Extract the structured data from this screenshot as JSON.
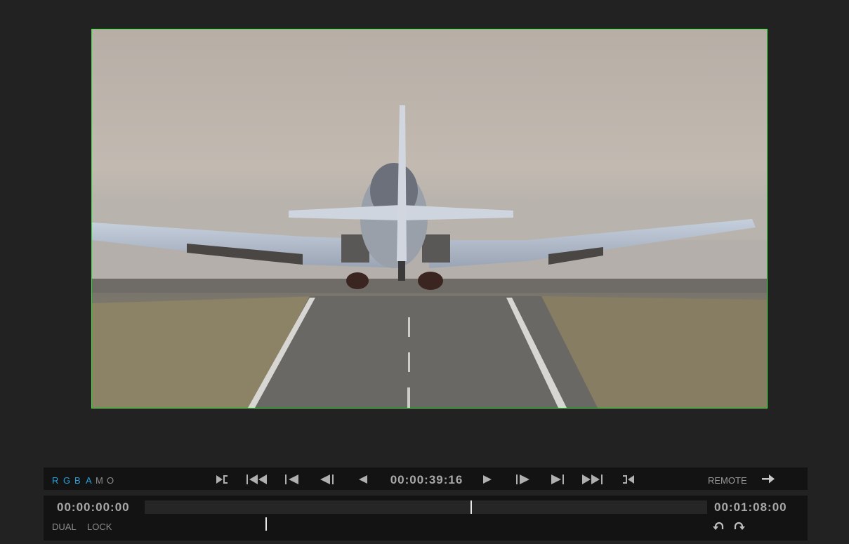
{
  "viewer": {
    "image_description_icon": "airplane-landing-frame",
    "border_color": "#3fe03f"
  },
  "channels": [
    {
      "label": "R",
      "active": true
    },
    {
      "label": "G",
      "active": true
    },
    {
      "label": "B",
      "active": true
    },
    {
      "label": "A",
      "active": true
    },
    {
      "label": "M",
      "active": false
    },
    {
      "label": "O",
      "active": false
    }
  ],
  "transport": {
    "current_timecode": "00:00:39:16",
    "remote_label": "REMOTE",
    "buttons": [
      "mark-in-icon",
      "skip-to-start-icon",
      "previous-clip-icon",
      "step-back-icon",
      "play-reverse-icon",
      "play-icon",
      "step-forward-icon",
      "next-clip-icon",
      "skip-to-end-icon",
      "mark-out-icon"
    ]
  },
  "timeline": {
    "start_timecode": "00:00:00:00",
    "end_timecode": "00:01:08:00",
    "playhead_fraction": 0.581,
    "dual_label": "DUAL",
    "lock_label": "LOCK"
  },
  "colors": {
    "background": "#222222",
    "bar": "#131313",
    "accent": "#2aa0d8",
    "text": "#9a9a9a"
  }
}
